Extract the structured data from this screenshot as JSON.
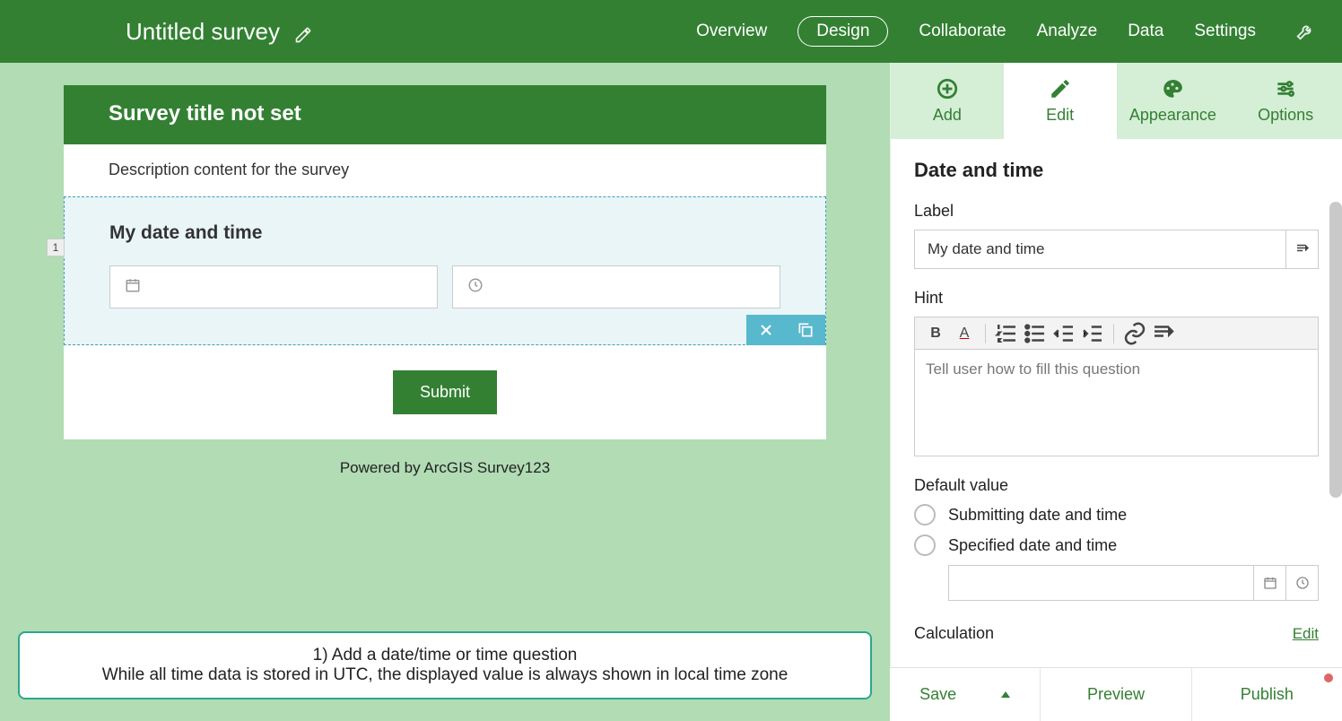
{
  "header": {
    "title": "Untitled survey",
    "nav": {
      "overview": "Overview",
      "design": "Design",
      "collaborate": "Collaborate",
      "analyze": "Analyze",
      "data": "Data",
      "settings": "Settings"
    }
  },
  "survey": {
    "title": "Survey title not set",
    "description": "Description content for the survey",
    "question": {
      "number": "1",
      "label": "My date and time"
    },
    "submit": "Submit",
    "powered": "Powered by ArcGIS Survey123"
  },
  "tutorial": {
    "line1": "1) Add a date/time or time question",
    "line2": "While all time data is stored in UTC, the displayed value is always shown in local time zone"
  },
  "panel": {
    "tabs": {
      "add": "Add",
      "edit": "Edit",
      "appearance": "Appearance",
      "options": "Options"
    },
    "heading": "Date and time",
    "label_label": "Label",
    "label_value": "My date and time",
    "hint_label": "Hint",
    "hint_placeholder": "Tell user how to fill this question",
    "default_label": "Default value",
    "default_opts": {
      "submitting": "Submitting date and time",
      "specified": "Specified date and time"
    },
    "calculation_label": "Calculation",
    "calculation_edit": "Edit"
  },
  "footer": {
    "save": "Save",
    "preview": "Preview",
    "publish": "Publish"
  }
}
